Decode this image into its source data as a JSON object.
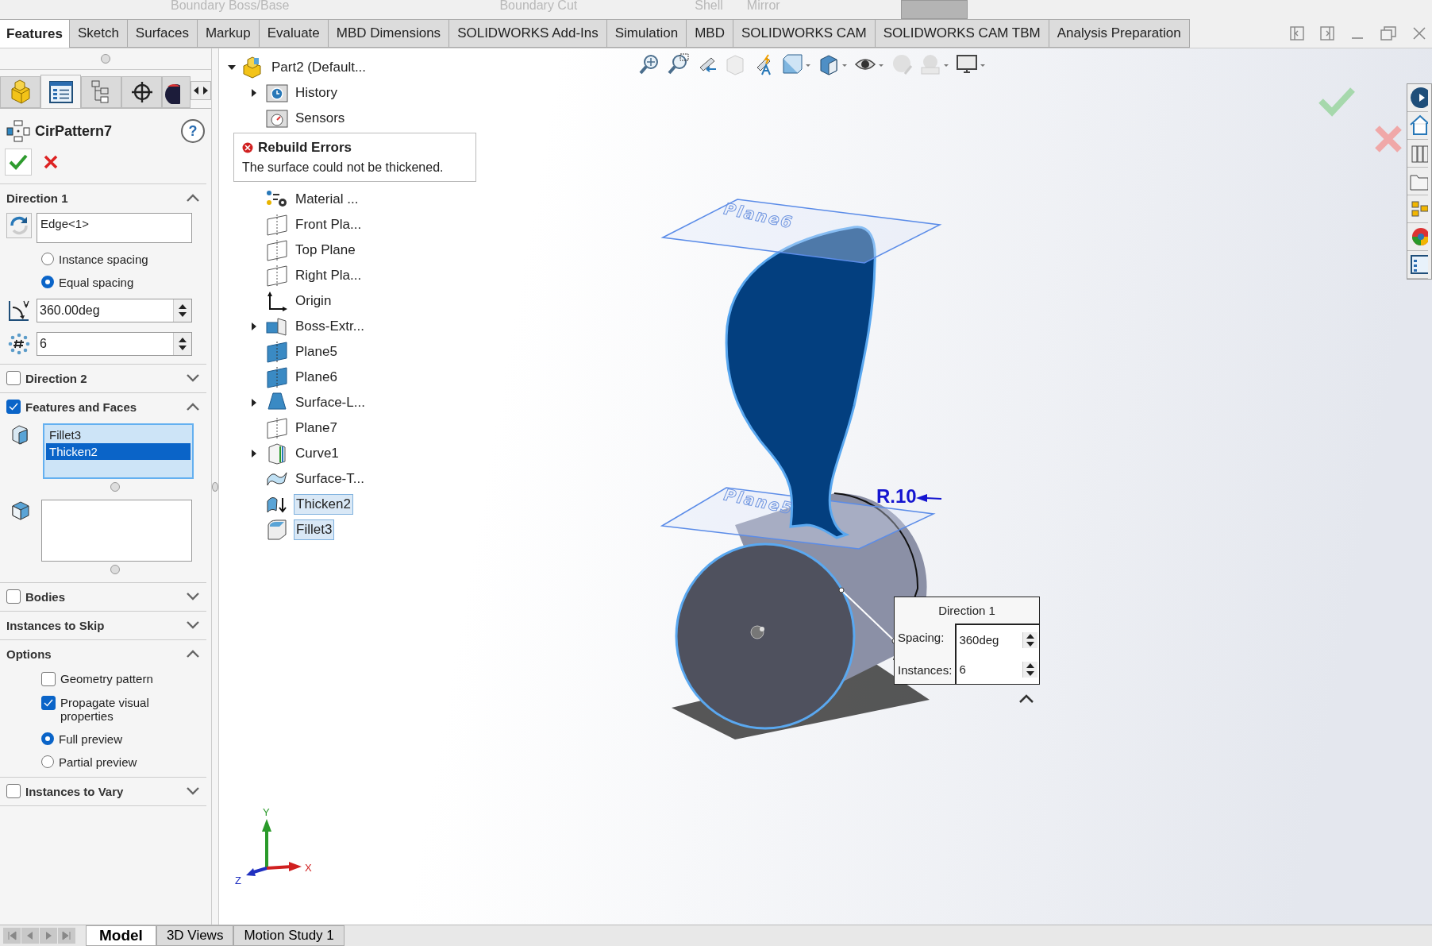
{
  "ribbon_faded": [
    "Boundary Boss/Base",
    "Boundary Cut",
    "Shell",
    "Mirror"
  ],
  "tabs": [
    {
      "label": "Features",
      "selected": true
    },
    {
      "label": "Sketch",
      "selected": false
    },
    {
      "label": "Surfaces",
      "selected": false
    },
    {
      "label": "Markup",
      "selected": false
    },
    {
      "label": "Evaluate",
      "selected": false
    },
    {
      "label": "MBD Dimensions",
      "selected": false
    },
    {
      "label": "SOLIDWORKS Add-Ins",
      "selected": false
    },
    {
      "label": "Simulation",
      "selected": false
    },
    {
      "label": "MBD",
      "selected": false
    },
    {
      "label": "SOLIDWORKS CAM",
      "selected": false
    },
    {
      "label": "SOLIDWORKS CAM TBM",
      "selected": false
    },
    {
      "label": "Analysis Preparation",
      "selected": false
    }
  ],
  "property_manager": {
    "panel_tabs": [
      {
        "kind": "part",
        "selected": false
      },
      {
        "kind": "list",
        "selected": true
      },
      {
        "kind": "config",
        "selected": false
      },
      {
        "kind": "target",
        "selected": false
      },
      {
        "kind": "appearance",
        "selected": false
      }
    ],
    "title": "CirPattern7",
    "help": "?",
    "sections": [
      {
        "kind": "direction",
        "title": "Direction 1",
        "expanded": true,
        "edge": "Edge<1>",
        "options": [
          {
            "label": "Instance spacing",
            "selected": false
          },
          {
            "label": "Equal spacing",
            "selected": true
          }
        ],
        "angle": "360.00deg",
        "count": "6"
      },
      {
        "kind": "header",
        "title": "Direction 2",
        "checked": false,
        "expanded": false
      },
      {
        "kind": "features",
        "title": "Features and Faces",
        "checked": true,
        "expanded": true,
        "items": [
          {
            "label": "Fillet3",
            "selected": false
          },
          {
            "label": "Thicken2",
            "selected": true
          }
        ]
      },
      {
        "kind": "header",
        "title": "Bodies",
        "checked": false,
        "expanded": false
      },
      {
        "kind": "header",
        "title": "Instances to Skip",
        "expanded": false
      },
      {
        "kind": "options",
        "title": "Options",
        "expanded": true,
        "checks": [
          {
            "label": "Geometry pattern",
            "checked": false
          },
          {
            "label": "Propagate visual properties",
            "checked": true
          }
        ],
        "previews": [
          {
            "label": "Full preview",
            "selected": true
          },
          {
            "label": "Partial preview",
            "selected": false
          }
        ]
      },
      {
        "kind": "header",
        "title": "Instances to Vary",
        "checked": false,
        "expanded": false
      }
    ]
  },
  "tree": {
    "label": "Part2 (Default...",
    "kind": "part",
    "expanded": true,
    "children": [
      {
        "label": "History",
        "kind": "history",
        "expanded": false,
        "selected": false
      },
      {
        "label": "Sensors",
        "kind": "sensors",
        "selected": false
      },
      {
        "label": "Material ...",
        "kind": "material",
        "selected": false
      },
      {
        "label": "Front Pla...",
        "kind": "plane",
        "selected": false
      },
      {
        "label": "Top Plane",
        "kind": "plane",
        "selected": false
      },
      {
        "label": "Right Pla...",
        "kind": "plane",
        "selected": false
      },
      {
        "label": "Origin",
        "kind": "origin",
        "selected": false
      },
      {
        "label": "Boss-Extr...",
        "kind": "boss",
        "expanded": false,
        "selected": false
      },
      {
        "label": "Plane5",
        "kind": "plane_solid",
        "selected": false
      },
      {
        "label": "Plane6",
        "kind": "plane_solid",
        "selected": false
      },
      {
        "label": "Surface-L...",
        "kind": "loft",
        "expanded": false,
        "selected": false
      },
      {
        "label": "Plane7",
        "kind": "plane",
        "selected": false
      },
      {
        "label": "Curve1",
        "kind": "curve",
        "expanded": false,
        "selected": false
      },
      {
        "label": "Surface-T...",
        "kind": "surface",
        "selected": false
      },
      {
        "label": "Thicken2",
        "kind": "thicken",
        "selected": true
      },
      {
        "label": "Fillet3",
        "kind": "fillet",
        "selected": true
      }
    ]
  },
  "rebuild_error": {
    "title": "Rebuild Errors",
    "message": "The surface could not be thickened."
  },
  "viewport": {
    "plane_labels": [
      "Plane6",
      "Plane5"
    ],
    "dimension": "R.10",
    "popup": {
      "title": "Direction 1",
      "fields": [
        {
          "label": "Spacing:",
          "value": "360deg"
        },
        {
          "label": "Instances:",
          "value": "6"
        }
      ]
    },
    "axes": [
      "X",
      "Y",
      "Z"
    ]
  },
  "bottom_tabs": [
    {
      "label": "Model",
      "selected": true
    },
    {
      "label": "3D Views",
      "selected": false
    },
    {
      "label": "Motion Study 1",
      "selected": false
    }
  ]
}
